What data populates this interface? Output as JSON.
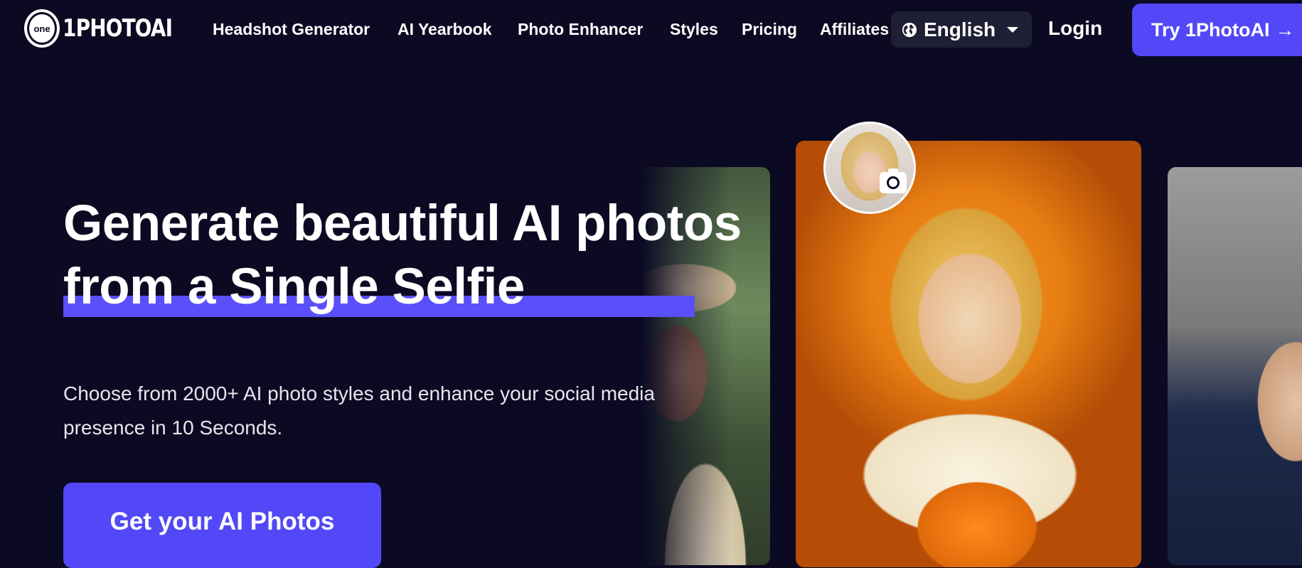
{
  "brand": {
    "logo_mark": "one",
    "name": "1PHOTOAI"
  },
  "nav": {
    "links": [
      {
        "label": "Headshot Generator"
      },
      {
        "label": "AI Yearbook"
      },
      {
        "label": "Photo Enhancer"
      },
      {
        "label": "Styles"
      },
      {
        "label": "Pricing"
      },
      {
        "label": "Affiliates"
      }
    ],
    "language": {
      "selected": "English",
      "icon": "globe-icon"
    },
    "login_label": "Login",
    "cta_label": "Try 1PhotoAI",
    "cta_arrow": "→"
  },
  "hero": {
    "title_line1": "Generate beautiful AI photos",
    "title_line2": "from a Single Selfie",
    "subtitle": "Choose from 2000+ AI photo styles and enhance your social media presence in 10 Seconds.",
    "cta_label": "Get your AI Photos"
  },
  "colors": {
    "background": "#0b0a22",
    "accent": "#5248f7",
    "highlight": "#5a4ff8",
    "text": "#ffffff"
  }
}
